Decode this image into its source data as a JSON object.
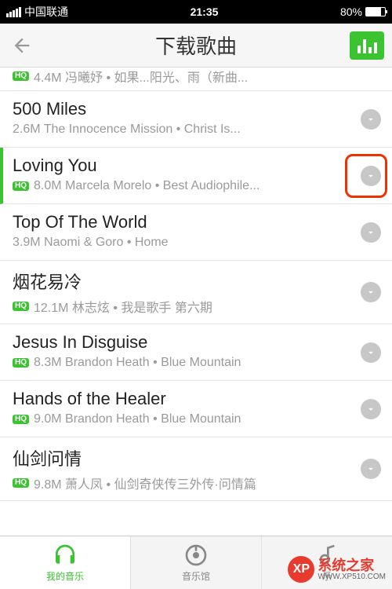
{
  "status": {
    "carrier": "中国联通",
    "time": "21:35",
    "battery_pct": "80%"
  },
  "header": {
    "title": "下载歌曲"
  },
  "partial_row": {
    "hq": "HQ",
    "subtitle": "4.4M 冯曦妤 • 如果...阳光、雨（新曲..."
  },
  "songs": [
    {
      "title": "500 Miles",
      "hq": false,
      "size": "2.6M",
      "artist_album": "The Innocence Mission • Christ Is...",
      "playing": false,
      "highlight": false
    },
    {
      "title": "Loving You",
      "hq": true,
      "size": "8.0M",
      "artist_album": "Marcela Morelo • Best Audiophile...",
      "playing": true,
      "highlight": true
    },
    {
      "title": "Top Of The World",
      "hq": false,
      "size": "3.9M",
      "artist_album": "Naomi & Goro • Home",
      "playing": false,
      "highlight": false
    },
    {
      "title": "烟花易冷",
      "hq": true,
      "size": "12.1M",
      "artist_album": "林志炫 • 我是歌手 第六期",
      "playing": false,
      "highlight": false
    },
    {
      "title": "Jesus In Disguise",
      "hq": true,
      "size": "8.3M",
      "artist_album": "Brandon Heath • Blue Mountain",
      "playing": false,
      "highlight": false
    },
    {
      "title": "Hands of the Healer",
      "hq": true,
      "size": "9.0M",
      "artist_album": "Brandon Heath • Blue Mountain",
      "playing": false,
      "highlight": false
    },
    {
      "title": "仙剑问情",
      "hq": true,
      "size": "9.8M",
      "artist_album": "萧人凤 • 仙剑奇侠传三外传·问情篇",
      "playing": false,
      "highlight": false
    }
  ],
  "hq_label": "HQ",
  "tabs": [
    {
      "label": "我的音乐",
      "active": true
    },
    {
      "label": "音乐馆",
      "active": false
    },
    {
      "label": "乐",
      "active": false
    }
  ],
  "watermark": {
    "badge": "XP",
    "name": "系统之家",
    "url": "WWW.XP510.COM"
  }
}
